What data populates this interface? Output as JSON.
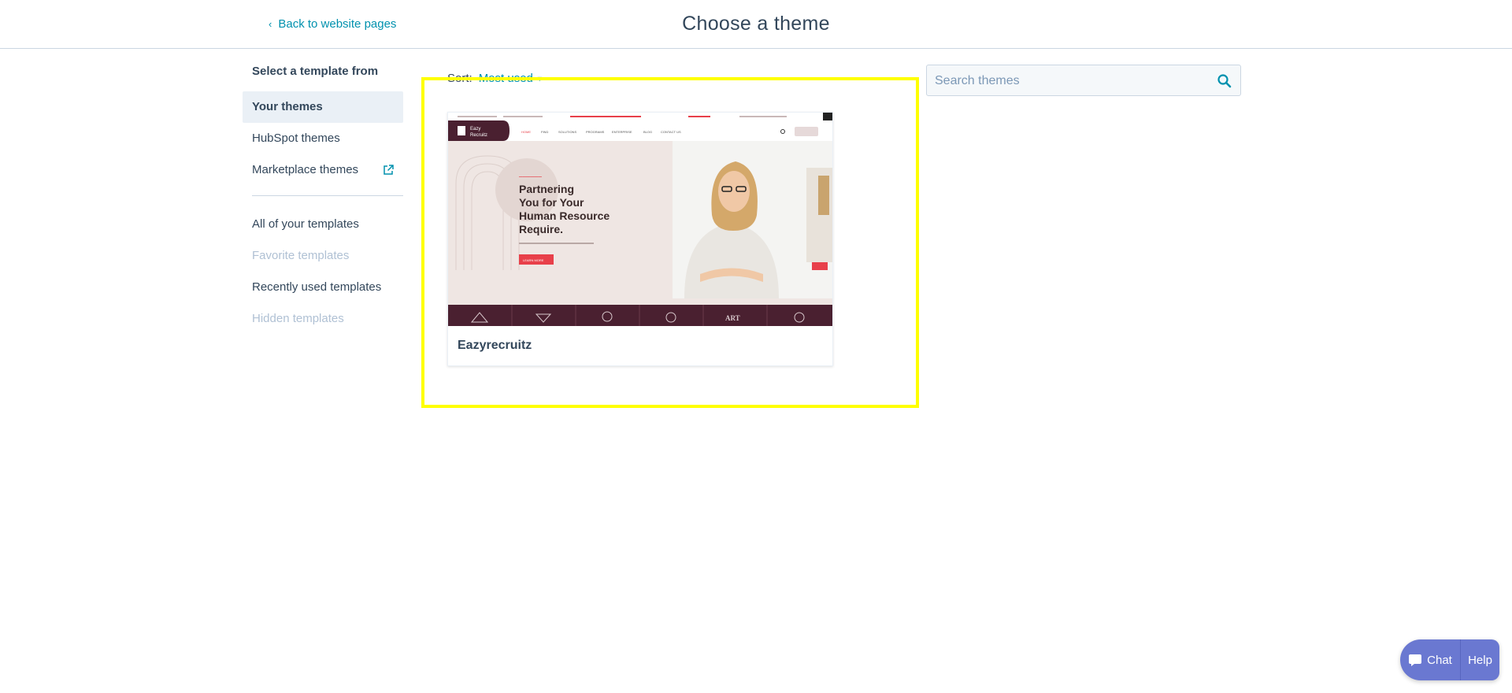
{
  "header": {
    "back_label": "Back to website pages",
    "title": "Choose a theme"
  },
  "sidebar": {
    "heading": "Select a template from",
    "theme_sources": [
      {
        "label": "Your themes",
        "active": true
      },
      {
        "label": "HubSpot themes",
        "active": false
      },
      {
        "label": "Marketplace themes",
        "active": false,
        "external": true
      }
    ],
    "template_filters": [
      {
        "label": "All of your templates",
        "enabled": true
      },
      {
        "label": "Favorite templates",
        "enabled": false
      },
      {
        "label": "Recently used templates",
        "enabled": true
      },
      {
        "label": "Hidden templates",
        "enabled": false
      }
    ]
  },
  "main": {
    "sort_label": "Sort:",
    "sort_value": "Most used",
    "themes": [
      {
        "name": "Eazyrecruitz",
        "preview": {
          "brand_line1": "Eazy",
          "brand_line2": "Recruitz",
          "headline_lines": [
            "Partnering",
            "You for Your",
            "Human Resource",
            "Require."
          ],
          "cta": "LEARN MORE",
          "nav_items": [
            "HOME",
            "FIND",
            "SOLUTIONS",
            "PROGRAMS",
            "ENTERPRISE",
            "BLOG",
            "CONTACT US"
          ],
          "partner_logos": [
            "ART"
          ]
        }
      }
    ]
  },
  "search": {
    "placeholder": "Search themes",
    "value": ""
  },
  "chat_widget": {
    "chat_label": "Chat",
    "help_label": "Help"
  },
  "colors": {
    "accent": "#0091ae",
    "text": "#33475b",
    "muted": "#b0c1d4",
    "active_bg": "#eaf0f6",
    "highlight": "#ffff00",
    "chat_bg": "#6a78d1",
    "preview_maroon": "#4a2030",
    "preview_red": "#e8404a"
  }
}
